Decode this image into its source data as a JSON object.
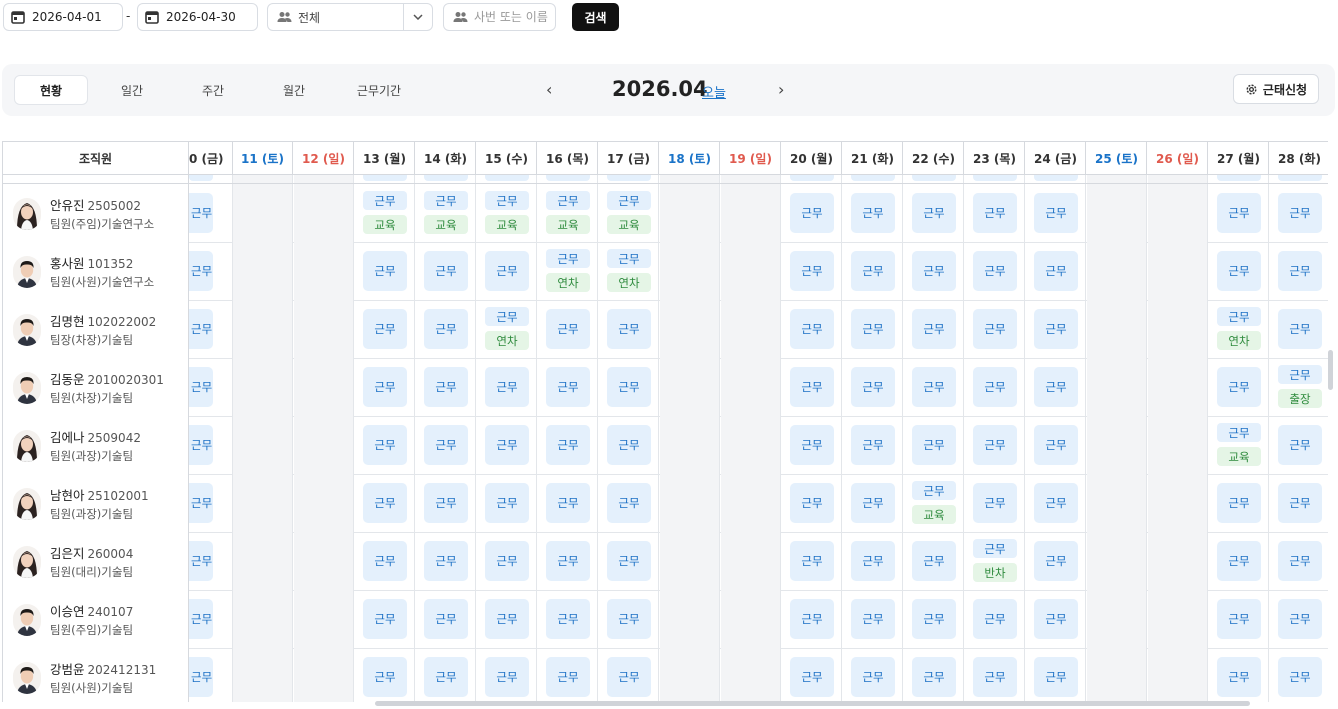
{
  "filters": {
    "start_date": "2026-04-01",
    "end_date": "2026-04-30",
    "separator": "-",
    "group_select": "전체",
    "search_placeholder": "사번 또는 이름",
    "search_button": "검색"
  },
  "toolbar": {
    "tabs": [
      "현황",
      "일간",
      "주간",
      "월간",
      "근무기간"
    ],
    "active_tab": "현황",
    "prev": "‹",
    "next": "›",
    "month": "2026.04",
    "today": "오늘",
    "apply_button": "근태신청"
  },
  "grid": {
    "org_header": "조직원",
    "days": [
      {
        "label": "0 (금)",
        "type": "weekday"
      },
      {
        "label": "11 (토)",
        "type": "sat"
      },
      {
        "label": "12 (일)",
        "type": "sun"
      },
      {
        "label": "13 (월)",
        "type": "weekday"
      },
      {
        "label": "14 (화)",
        "type": "weekday"
      },
      {
        "label": "15 (수)",
        "type": "weekday"
      },
      {
        "label": "16 (목)",
        "type": "weekday"
      },
      {
        "label": "17 (금)",
        "type": "weekday"
      },
      {
        "label": "18 (토)",
        "type": "sat"
      },
      {
        "label": "19 (일)",
        "type": "sun"
      },
      {
        "label": "20 (월)",
        "type": "weekday"
      },
      {
        "label": "21 (화)",
        "type": "weekday"
      },
      {
        "label": "22 (수)",
        "type": "weekday"
      },
      {
        "label": "23 (목)",
        "type": "weekday"
      },
      {
        "label": "24 (금)",
        "type": "weekday"
      },
      {
        "label": "25 (토)",
        "type": "sat"
      },
      {
        "label": "26 (일)",
        "type": "sun"
      },
      {
        "label": "27 (월)",
        "type": "weekday"
      },
      {
        "label": "28 (화)",
        "type": "weekday"
      }
    ],
    "work_label": "근무",
    "employees": [
      {
        "name": "안유진",
        "id": "2505002",
        "role": "팀원(주임)기술연구소",
        "gender": "f",
        "extras": {
          "13 (월)": "교육",
          "14 (화)": "교육",
          "15 (수)": "교육",
          "16 (목)": "교육",
          "17 (금)": "교육"
        }
      },
      {
        "name": "홍사원",
        "id": "101352",
        "role": "팀원(사원)기술연구소",
        "gender": "m",
        "extras": {
          "16 (목)": "연차",
          "17 (금)": "연차"
        }
      },
      {
        "name": "김명현",
        "id": "102022002",
        "role": "팀장(차장)기술팀",
        "gender": "m",
        "extras": {
          "15 (수)": "연차",
          "27 (월)": "연차"
        }
      },
      {
        "name": "김동운",
        "id": "2010020301",
        "role": "팀원(차장)기술팀",
        "gender": "m",
        "extras": {
          "28 (화)": "출장"
        }
      },
      {
        "name": "김에나",
        "id": "2509042",
        "role": "팀원(과장)기술팀",
        "gender": "f",
        "extras": {
          "27 (월)": "교육"
        }
      },
      {
        "name": "남현아",
        "id": "25102001",
        "role": "팀원(과장)기술팀",
        "gender": "f",
        "extras": {
          "22 (수)": "교육"
        }
      },
      {
        "name": "김은지",
        "id": "260004",
        "role": "팀원(대리)기술팀",
        "gender": "f",
        "extras": {
          "23 (목)": "반차"
        }
      },
      {
        "name": "이승연",
        "id": "240107",
        "role": "팀원(주임)기술팀",
        "gender": "m",
        "extras": {}
      },
      {
        "name": "강범윤",
        "id": "202412131",
        "role": "팀원(사원)기술팀",
        "gender": "m",
        "extras": {}
      }
    ]
  },
  "colors": {
    "work_bg": "#e4f0fc",
    "work_text": "#1a6fc4",
    "extra_bg": "#e5f5e6",
    "extra_text": "#2e8b3d",
    "saturday": "#1a73c8",
    "sunday": "#e05a4e",
    "weekend_bg": "#f3f4f6"
  }
}
